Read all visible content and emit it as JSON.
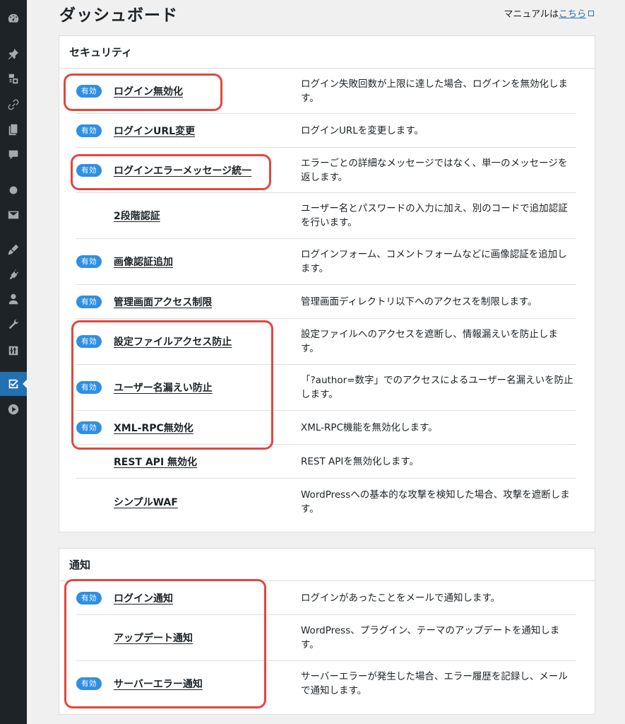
{
  "header": {
    "title": "ダッシュボード",
    "manual_prefix": "マニュアルは",
    "manual_link": "こちら"
  },
  "sidebar": {
    "icons": [
      "dashboard-icon",
      "pin-icon",
      "media-icon",
      "link-icon",
      "pages-icon",
      "comments-icon",
      "circle-icon",
      "mail-icon",
      "appearance-icon",
      "plugins-icon",
      "users-icon",
      "tools-icon",
      "settings-icon",
      "security-shield-icon",
      "play-icon"
    ]
  },
  "security": {
    "heading": "セキュリティ",
    "badge_label": "有効",
    "rows": [
      {
        "enabled": true,
        "label": "ログイン無効化",
        "desc": "ログイン失敗回数が上限に達した場合、ログインを無効化します。"
      },
      {
        "enabled": true,
        "label": "ログインURL変更",
        "desc": "ログインURLを変更します。"
      },
      {
        "enabled": true,
        "label": "ログインエラーメッセージ統一",
        "desc": "エラーごとの詳細なメッセージではなく、単一のメッセージを返します。"
      },
      {
        "enabled": false,
        "label": "2段階認証",
        "desc": "ユーザー名とパスワードの入力に加え、別のコードで追加認証を行います。"
      },
      {
        "enabled": true,
        "label": "画像認証追加",
        "desc": "ログインフォーム、コメントフォームなどに画像認証を追加します。"
      },
      {
        "enabled": true,
        "label": "管理画面アクセス制限",
        "desc": "管理画面ディレクトリ以下へのアクセスを制限します。"
      },
      {
        "enabled": true,
        "label": "設定ファイルアクセス防止",
        "desc": "設定ファイルへのアクセスを遮断し、情報漏えいを防止します。"
      },
      {
        "enabled": true,
        "label": "ユーザー名漏えい防止",
        "desc": "「?author=数字」でのアクセスによるユーザー名漏えいを防止します。"
      },
      {
        "enabled": true,
        "label": "XML-RPC無効化",
        "desc": "XML-RPC機能を無効化します。"
      },
      {
        "enabled": false,
        "label": "REST API 無効化",
        "desc": "REST APIを無効化します。"
      },
      {
        "enabled": false,
        "label": "シンプルWAF",
        "desc": "WordPressへの基本的な攻撃を検知した場合、攻撃を遮断します。"
      }
    ]
  },
  "notification": {
    "heading": "通知",
    "badge_label": "有効",
    "rows": [
      {
        "enabled": true,
        "label": "ログイン通知",
        "desc": "ログインがあったことをメールで通知します。"
      },
      {
        "enabled": false,
        "label": "アップデート通知",
        "desc": "WordPress、プラグイン、テーマのアップデートを通知します。"
      },
      {
        "enabled": true,
        "label": "サーバーエラー通知",
        "desc": "サーバーエラーが発生した場合、エラー履歴を記録し、メールで通知します。"
      }
    ]
  },
  "colors": {
    "sidebar_bg": "#1d2327",
    "active_menu": "#2271b1",
    "badge": "#2f8fe3",
    "highlight": "#e0473e"
  }
}
